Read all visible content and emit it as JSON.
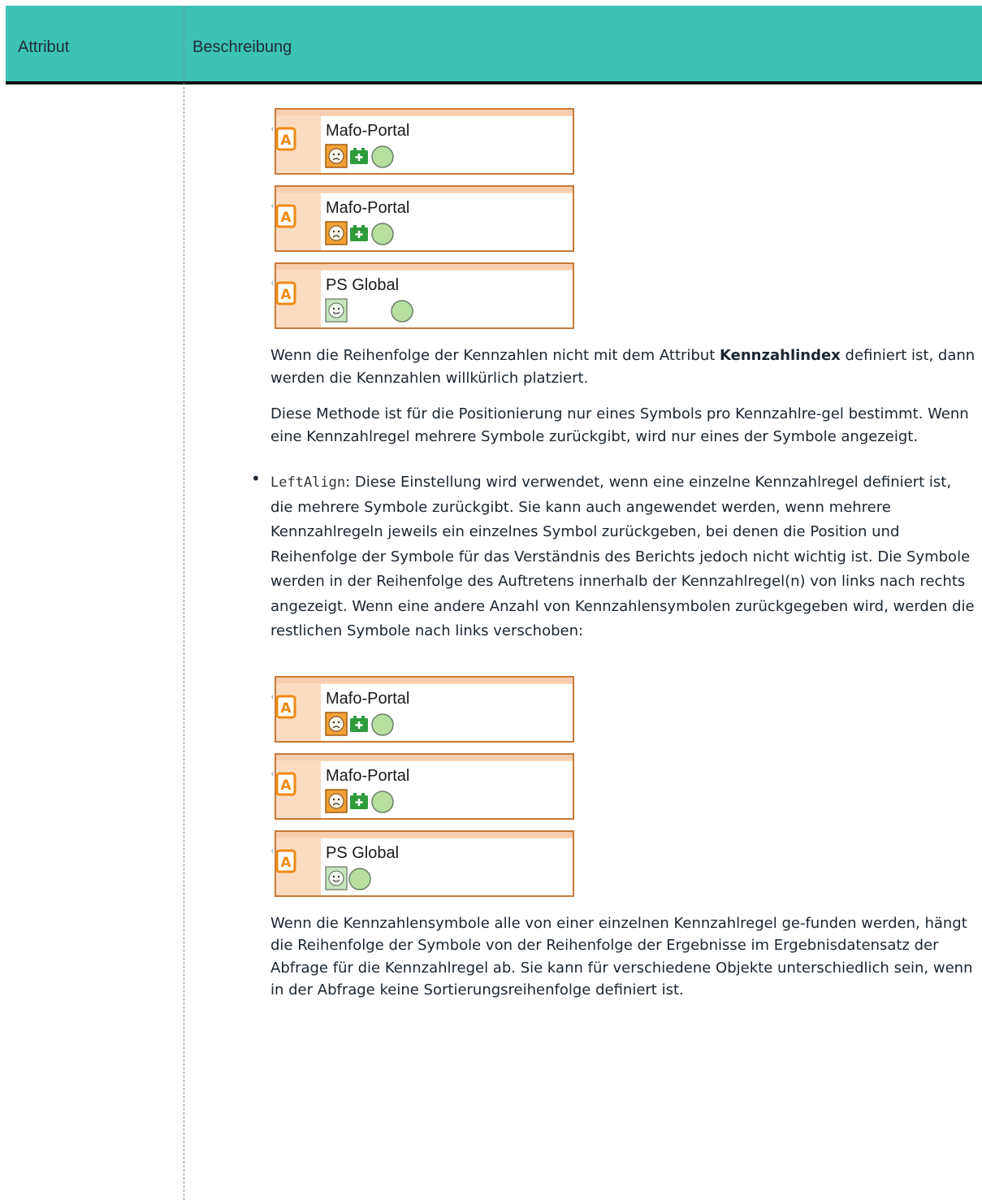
{
  "table": {
    "header": {
      "col1": "Attribut",
      "col2": "Beschreibung"
    }
  },
  "colors": {
    "header_bg": "#3cc3b5",
    "card_bg": "#fbdcc1",
    "card_border": "#c67a38",
    "badge_orange": "#ef8a14",
    "status_green": "#b6dfa0"
  },
  "figures": {
    "group1": [
      {
        "title": "Mafo-Portal",
        "icons": [
          "sad-face-icon",
          "battery-plus-icon",
          "green-circle-icon"
        ]
      },
      {
        "title": "Mafo-Portal",
        "icons": [
          "sad-face-icon",
          "battery-plus-icon",
          "green-circle-icon"
        ]
      },
      {
        "title": "PS Global",
        "icons": [
          "happy-face-icon",
          "green-circle-icon"
        ]
      }
    ],
    "group2": [
      {
        "title": "Mafo-Portal",
        "icons": [
          "sad-face-icon",
          "battery-plus-icon",
          "green-circle-icon"
        ]
      },
      {
        "title": "Mafo-Portal",
        "icons": [
          "sad-face-icon",
          "battery-plus-icon",
          "green-circle-icon"
        ]
      },
      {
        "title": "PS Global",
        "icons": [
          "happy-face-icon",
          "green-circle-icon"
        ]
      }
    ]
  },
  "text": {
    "p1_pre": "Wenn die Reihenfolge der Kennzahlen nicht mit dem Attribut ",
    "p1_bold": "Kennzahlindex",
    "p1_post": " definiert ist, dann werden die Kennzahlen willkürlich platziert.",
    "p2": "Diese Methode ist für die Positionierung nur eines Symbols pro Kennzahlre-gel bestimmt. Wenn eine Kennzahlregel mehrere Symbole zurückgibt, wird nur eines der Symbole angezeigt.",
    "bullet_code": "LeftAlign",
    "bullet_text": ": Diese Einstellung wird verwendet, wenn eine einzelne Kennzahlregel definiert ist, die mehrere Symbole zurückgibt. Sie kann auch angewendet werden, wenn mehrere Kennzahlregeln jeweils ein einzelnes Symbol zurückgeben, bei denen die Position und Reihenfolge der Symbole für das Verständnis des Berichts jedoch nicht wichtig ist. Die Symbole werden in der Reihenfolge des Auftretens innerhalb der Kennzahlregel(n) von links nach rechts angezeigt. Wenn eine andere Anzahl von Kennzahlensymbolen zurückgegeben wird, werden die restlichen Symbole nach links verschoben:",
    "p3": "Wenn die Kennzahlensymbole alle von einer einzelnen Kennzahlregel ge-funden werden, hängt die Reihenfolge der Symbole von der Reihenfolge der Ergebnisse im Ergebnisdatensatz der Abfrage für die Kennzahlregel ab. Sie kann für verschiedene Objekte unterschiedlich sein, wenn in der Abfrage keine Sortierungsreihenfolge definiert ist."
  }
}
